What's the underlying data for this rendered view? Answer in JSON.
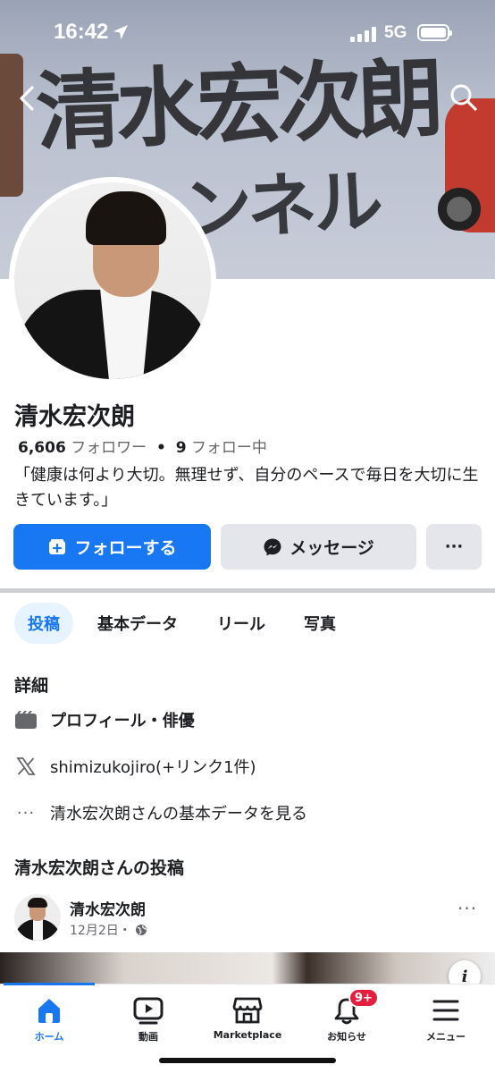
{
  "status_bar": {
    "time": "16:42",
    "network": "5G"
  },
  "cover": {
    "brush_line1": "清水宏次朗",
    "brush_line2": "ャンネル"
  },
  "profile": {
    "name": "清水宏次朗",
    "followers_count": "6,606",
    "followers_label": "フォロワー",
    "dot": "•",
    "following_count": "9",
    "following_label": "フォロー中",
    "bio": "「健康は何より大切。無理せず、自分のペースで毎日を大切に生きています。」"
  },
  "actions": {
    "follow_label": "フォローする",
    "message_label": "メッセージ",
    "more_label": "···"
  },
  "tabs": [
    {
      "label": "投稿",
      "active": true
    },
    {
      "label": "基本データ"
    },
    {
      "label": "リール"
    },
    {
      "label": "写真"
    }
  ],
  "details": {
    "title": "詳細",
    "rows": [
      {
        "icon": "clapperboard-icon",
        "text": "プロフィール・俳優"
      },
      {
        "icon": "x-logo-icon",
        "text": "shimizukojiro(+リンク1件)"
      },
      {
        "icon": "more-dots-icon",
        "text": "清水宏次朗さんの基本データを見る"
      }
    ]
  },
  "posts": {
    "title": "清水宏次朗さんの投稿",
    "first_post": {
      "author": "清水宏次朗",
      "date": "12月2日・",
      "audience_icon": "globe-icon"
    }
  },
  "bottom_nav": [
    {
      "label": "ホーム",
      "icon": "home-icon",
      "active": true
    },
    {
      "label": "動画",
      "icon": "video-icon"
    },
    {
      "label": "Marketplace",
      "icon": "marketplace-icon"
    },
    {
      "label": "お知らせ",
      "icon": "bell-icon",
      "badge": "9+"
    },
    {
      "label": "メニュー",
      "icon": "menu-icon"
    }
  ],
  "colors": {
    "accent": "#1877f2",
    "badge": "#e41e3f",
    "button_gray": "#e4e6eb"
  }
}
